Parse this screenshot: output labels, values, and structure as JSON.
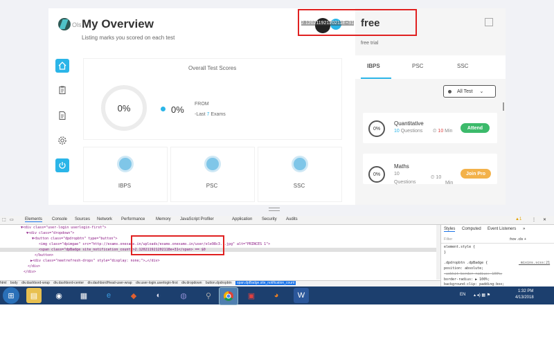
{
  "app": {
    "logo_text": "Ols",
    "title": "My Overview",
    "subtitle": "Listing marks you scored on each test",
    "profile": {
      "badge_text": "2.12021192120211E+31",
      "plan": "free",
      "plan_note": "free trial"
    },
    "overall": {
      "title": "Overall Test Scores",
      "ring_pct": "0%",
      "legend_pct": "0%",
      "from_label": "FROM",
      "last_prefix": "-Last ",
      "last_count": "7",
      "last_suffix": " Exams"
    },
    "exam_cards": [
      {
        "label": "IBPS"
      },
      {
        "label": "PSC"
      },
      {
        "label": "SSC"
      }
    ],
    "tabs": [
      {
        "label": "IBPS"
      },
      {
        "label": "PSC"
      },
      {
        "label": "SSC"
      }
    ],
    "filter": {
      "selected": "All Test",
      "caret": "⌄"
    },
    "subjects": [
      {
        "pct": "0%",
        "name": "Quantitative",
        "questions_num": "10",
        "questions_label": " Questions",
        "min_num": "10",
        "min_label": " Min",
        "action": "Attend"
      },
      {
        "pct": "0%",
        "name": "Maths",
        "questions_num": "10",
        "questions_label": "Questions",
        "min_num": "10",
        "min_label": "Min",
        "action": "Join Pro"
      }
    ],
    "colors": {
      "accent": "#2bb5e8",
      "attend": "#3cba6b",
      "join": "#f3b24a",
      "highlight": "#e02020"
    }
  },
  "devtools": {
    "tabs": [
      "Elements",
      "Console",
      "Sources",
      "Network",
      "Performance",
      "Memory",
      "JavaScript Profiler",
      "Application",
      "Security",
      "Audits"
    ],
    "warning_count": "1",
    "code_lines": [
      "▼<div class=\"user-login userlogin-first\">",
      "▼<div class=\"dropdown\">",
      "▼<button class=\"dpdropbtn\" type=\"button\">",
      "<img class=\"dpimgae\" src=\"http://exams.onexams.in/uploads/exams.onexams.in/user/ele98c3...jpg\" alt=\"PRINCES 1\">",
      "<span class=\"dpBadge site_notification_count\">2.120211921202118e+31</span> == $0",
      "</button>",
      "▶<div class=\"neetrefresh-drops\" style=\"display: none;\">…</div>",
      "</div>",
      "</div>"
    ],
    "breadcrumb": [
      "html",
      "body",
      "div.dashbord-wrap",
      "div.dashbord-center",
      "div.dashbordHead-user-wrap",
      "div.user-login.userlogin-first",
      "div.dropdown",
      "button.dpdropbtn",
      "span.dpBadge.site_notification_count"
    ],
    "styles_tabs": [
      "Styles",
      "Computed",
      "Event Listeners",
      "»"
    ],
    "filter_placeholder": "Filter",
    "filter_hints": ":hov  .cls  +",
    "style_lines": [
      "element.style {",
      "}",
      ".dpdropbtn .dpBadge {",
      "  position: absolute;",
      "  -webkit-border-radius: 100%;",
      "  border-radius: ▶ 100%;",
      "  background-clip: padding-box;"
    ],
    "style_source": "_mixins.scss:21"
  },
  "taskbar": {
    "lang": "EN",
    "time": "1:32 PM",
    "date": "4/13/2018"
  }
}
